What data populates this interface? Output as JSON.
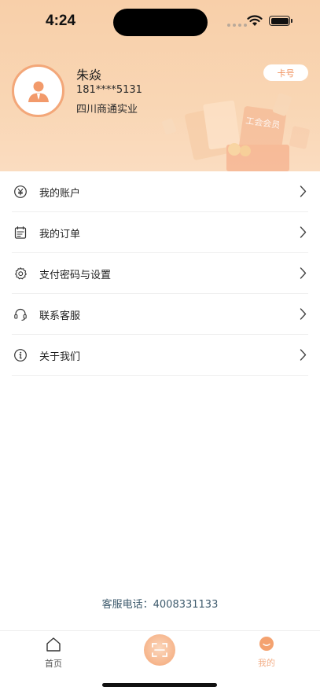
{
  "status_bar": {
    "time": "4:24"
  },
  "profile": {
    "name": "朱焱",
    "phone": "181****5131",
    "company": "四川商通实业",
    "card_button": "卡号"
  },
  "illustration": {
    "badge_text": "工会会员"
  },
  "menu": [
    {
      "label": "我的账户",
      "icon": "yen-icon"
    },
    {
      "label": "我的订单",
      "icon": "calendar-order-icon"
    },
    {
      "label": "支付密码与设置",
      "icon": "gear-icon"
    },
    {
      "label": "联系客服",
      "icon": "headset-icon"
    },
    {
      "label": "关于我们",
      "icon": "info-icon"
    }
  ],
  "service_phone": "客服电话：4008331133",
  "tabs": {
    "home": "首页",
    "mine": "我的"
  },
  "colors": {
    "accent": "#f3a779",
    "header_bg": "#f9d3af",
    "phone_text": "#3d5a6c"
  }
}
